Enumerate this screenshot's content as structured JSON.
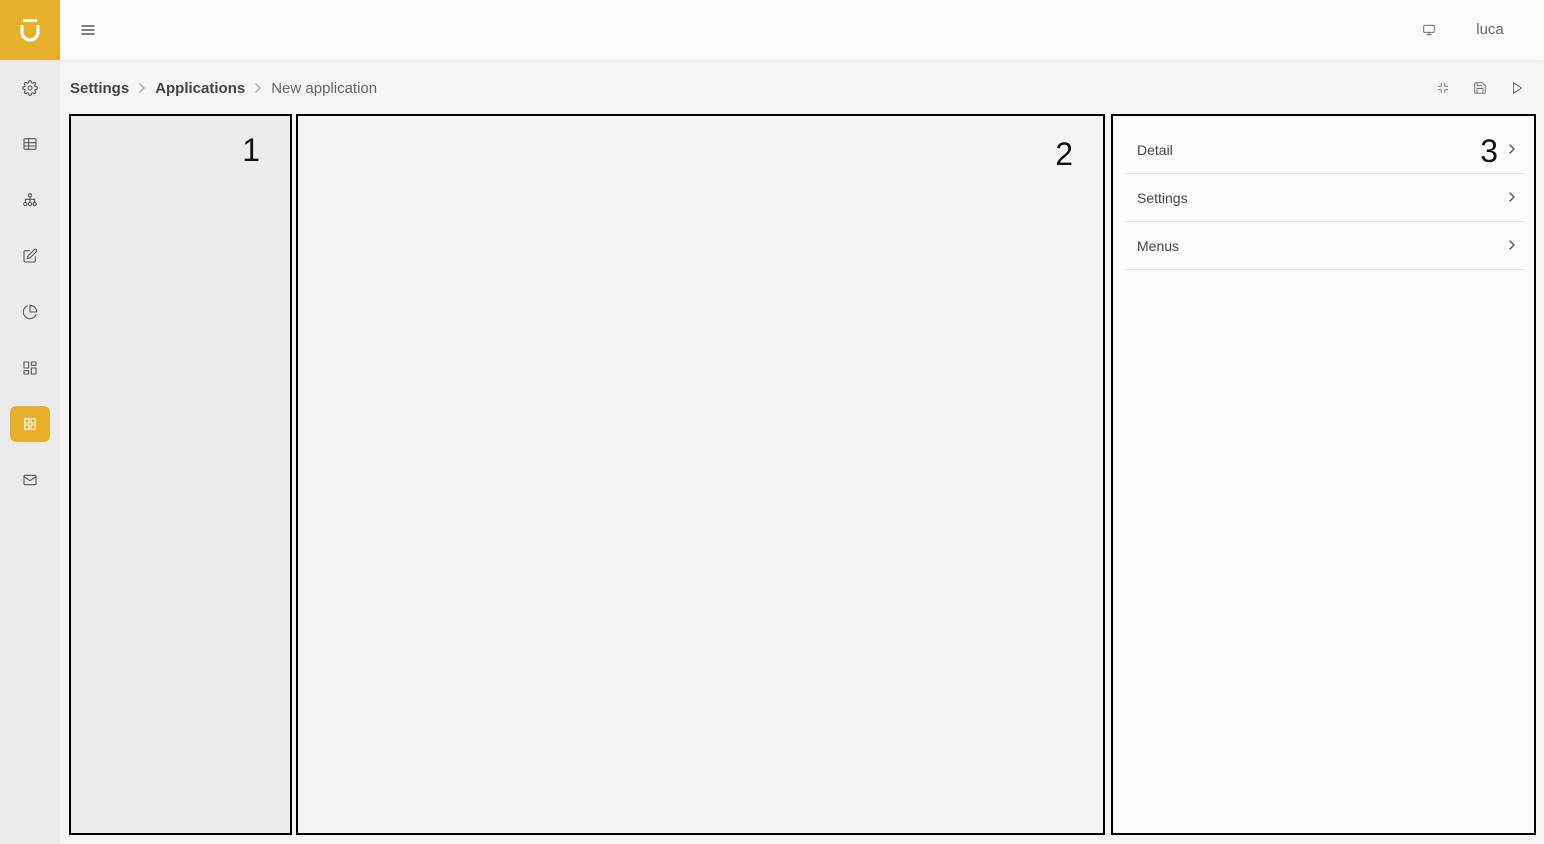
{
  "header": {
    "user_name": "luca",
    "menu_icon": "hamburger-icon",
    "display_icon": "monitor-icon"
  },
  "brand": {
    "logo_icon": "u-logo-icon",
    "accent_color": "#e6af2e"
  },
  "sidebar": {
    "items": [
      {
        "icon": "gear-icon",
        "active": false
      },
      {
        "icon": "table-icon",
        "active": false
      },
      {
        "icon": "hierarchy-icon",
        "active": false
      },
      {
        "icon": "edit-icon",
        "active": false
      },
      {
        "icon": "pie-chart-icon",
        "active": false
      },
      {
        "icon": "dashboard-icon",
        "active": false
      },
      {
        "icon": "apps-grid-icon",
        "active": true
      },
      {
        "icon": "mail-icon",
        "active": false
      }
    ]
  },
  "breadcrumb": {
    "items": [
      "Settings",
      "Applications"
    ],
    "current": "New application"
  },
  "toolbar": {
    "buttons": [
      "collapse-icon",
      "save-icon",
      "play-icon"
    ]
  },
  "panels": {
    "p1_label": "1",
    "p2_label": "2",
    "p3_label": "3"
  },
  "properties_menu": {
    "items": [
      "Detail",
      "Settings",
      "Menus"
    ]
  }
}
